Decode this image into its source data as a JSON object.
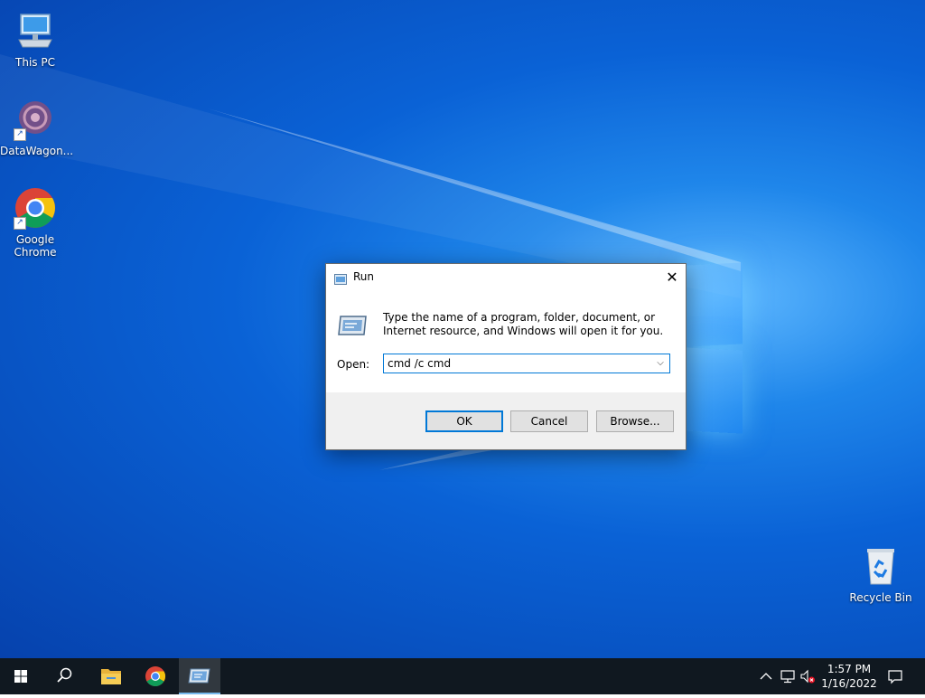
{
  "desktop": {
    "icons": [
      {
        "label": "This PC",
        "icon": "this-pc-icon"
      },
      {
        "label": "DataWagon...",
        "icon": "datawagon-icon"
      },
      {
        "label": "Google Chrome",
        "icon": "chrome-icon"
      },
      {
        "label": "Recycle Bin",
        "icon": "recycle-bin-icon"
      }
    ]
  },
  "run_dialog": {
    "title": "Run",
    "description": "Type the name of a program, folder, document, or Internet resource, and Windows will open it for you.",
    "open_label": "Open:",
    "open_value": "cmd /c cmd",
    "close_glyph": "✕",
    "dropdown_glyph": "⌵",
    "buttons": {
      "ok": "OK",
      "cancel": "Cancel",
      "browse": "Browse..."
    }
  },
  "taskbar": {
    "items": [
      "start-icon",
      "search-icon",
      "file-explorer-icon",
      "chrome-icon",
      "run-icon"
    ],
    "active_item": "run-icon",
    "tray": {
      "time": "1:57 PM",
      "date": "1/16/2022",
      "icons": [
        "chevron-up-icon",
        "network-icon",
        "volume-muted-icon",
        "notification-icon"
      ]
    }
  },
  "colors": {
    "accent": "#0078d7",
    "taskbar": "#101820",
    "desktop": "#0a62d6"
  }
}
